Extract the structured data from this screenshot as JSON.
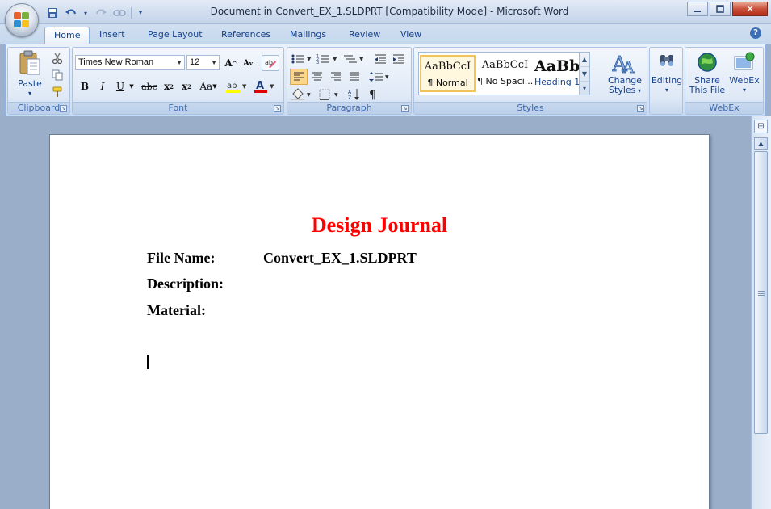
{
  "window": {
    "title": "Document in Convert_EX_1.SLDPRT [Compatibility Mode] - Microsoft Word",
    "minimize_icon": "minimize-icon",
    "maximize_icon": "maximize-icon",
    "close_icon": "close-icon"
  },
  "tabs": [
    "Home",
    "Insert",
    "Page Layout",
    "References",
    "Mailings",
    "Review",
    "View"
  ],
  "active_tab": "Home",
  "ribbon": {
    "clipboard": {
      "label": "Clipboard",
      "paste": "Paste"
    },
    "font": {
      "label": "Font",
      "font_name": "Times New Roman",
      "font_size": "12"
    },
    "paragraph": {
      "label": "Paragraph"
    },
    "styles": {
      "label": "Styles",
      "items": [
        {
          "sample": "AaBbCcI",
          "name": "¶ Normal"
        },
        {
          "sample": "AaBbCcI",
          "name": "¶ No Spaci..."
        },
        {
          "sample": "AaBbC",
          "name": "Heading 1"
        }
      ],
      "change_styles_1": "Change",
      "change_styles_2": "Styles"
    },
    "editing": {
      "label": "Editing"
    },
    "webex": {
      "label": "WebEx",
      "share_1": "Share",
      "share_2": "This File",
      "webex_btn": "WebEx"
    }
  },
  "document": {
    "title": "Design Journal",
    "file_name_label": "File Name:",
    "file_name_value": "Convert_EX_1.SLDPRT",
    "description_label": "Description:",
    "material_label": "Material:"
  },
  "colors": {
    "title_red": "#ff0000",
    "ribbon_blue": "#15428b"
  }
}
